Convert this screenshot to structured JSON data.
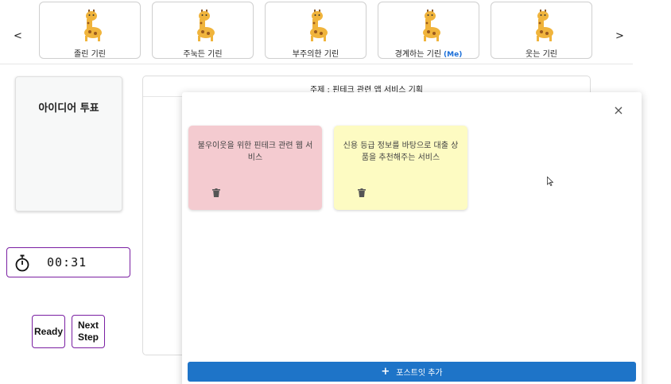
{
  "nav": {
    "prev": "<",
    "next": ">"
  },
  "participants": [
    {
      "name": "졸린 기린",
      "is_me": false
    },
    {
      "name": "주눅든 기린",
      "is_me": false
    },
    {
      "name": "부주의한 기린",
      "is_me": false
    },
    {
      "name": "경계하는 기린",
      "is_me": true,
      "me_badge": "(Me)"
    },
    {
      "name": "웃는 기린",
      "is_me": false
    }
  ],
  "stage": {
    "title": "아이디어 투표"
  },
  "timer": {
    "value": "00:31"
  },
  "buttons": {
    "ready": "Ready",
    "next_step": "Next Step"
  },
  "board": {
    "topic": "주제 : 핀테크 관련 앱 서비스 기획"
  },
  "modal": {
    "close": "×",
    "notes": [
      {
        "text": "불우이웃을 위한 핀테크 관련 웹 서비스",
        "color": "#f4cbd0"
      },
      {
        "text": "신용 등급 정보를 바탕으로 대출 상품을 추천해주는 서비스",
        "color": "#fdfbc2"
      }
    ],
    "add_button": {
      "icon": "+",
      "label": "포스트잇 추가"
    }
  },
  "colors": {
    "accent_purple": "#7a1fa2",
    "primary_blue": "#1e74c8",
    "me_badge": "#1a6ed8"
  }
}
